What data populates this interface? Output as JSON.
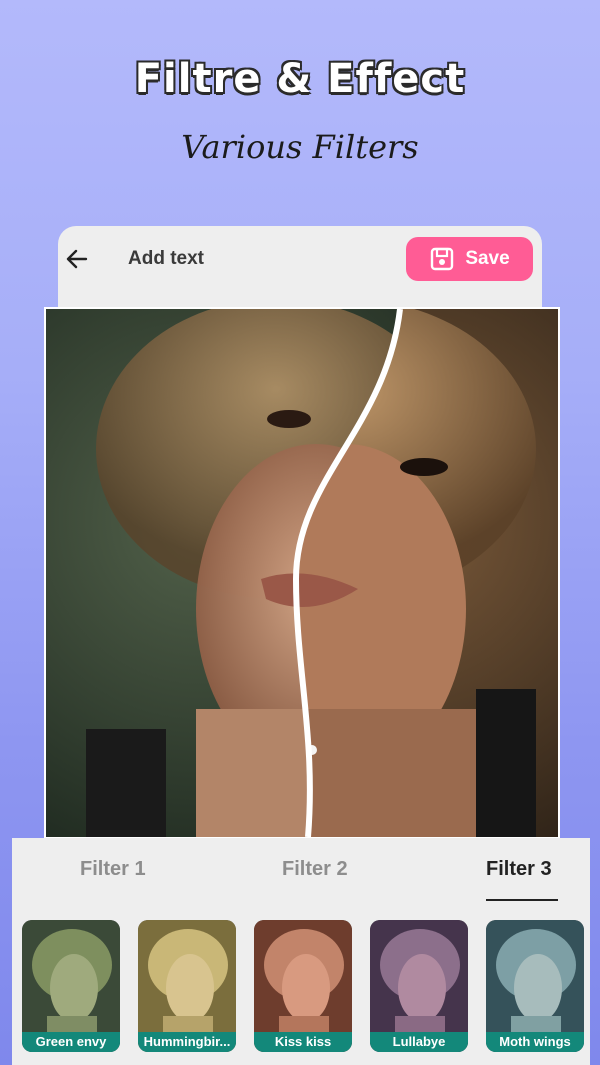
{
  "promo": {
    "headline": "Filtre & Effect",
    "subline": "Various Filters"
  },
  "header": {
    "back_icon": "arrow-left-icon",
    "title": "Add text",
    "save_label": "Save",
    "save_icon": "floppy-disk-icon",
    "save_color": "#ff5c95"
  },
  "tabs": [
    {
      "label": "Filter 1",
      "active": false
    },
    {
      "label": "Filter 2",
      "active": false
    },
    {
      "label": "Filter 3",
      "active": true
    }
  ],
  "filters": [
    {
      "name": "Green envy",
      "tint": "#4f7f4a"
    },
    {
      "name": "Hummingbir...",
      "tint": "#b1a35a"
    },
    {
      "name": "Kiss kiss",
      "tint": "#b46e55"
    },
    {
      "name": "Lullabye",
      "tint": "#7a5d80"
    },
    {
      "name": "Moth wings",
      "tint": "#5f8b90"
    }
  ],
  "colors": {
    "label_bg": "#13887a",
    "panel_bg": "#eeeeee"
  }
}
